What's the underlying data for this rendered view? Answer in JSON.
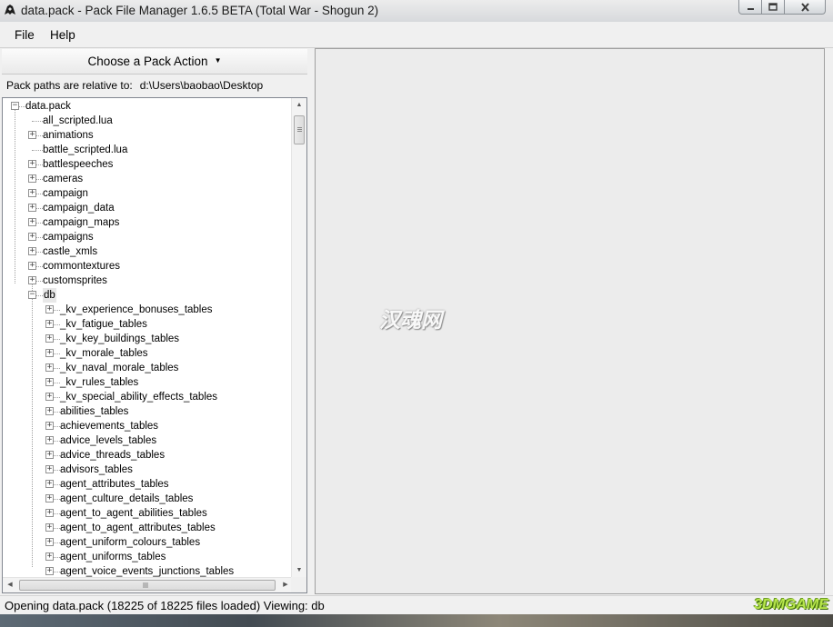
{
  "window": {
    "title": "data.pack - Pack File Manager 1.6.5 BETA (Total War - Shogun 2)"
  },
  "menu": [
    "File",
    "Help"
  ],
  "left_panel": {
    "action_button": "Choose a Pack Action",
    "paths_label": "Pack paths are relative to:",
    "paths_value": "d:\\Users\\baobao\\Desktop"
  },
  "tree": {
    "root": "data.pack",
    "items": [
      {
        "label": "all_scripted.lua",
        "level": 1,
        "expandable": false
      },
      {
        "label": "animations",
        "level": 1,
        "expandable": true
      },
      {
        "label": "battle_scripted.lua",
        "level": 1,
        "expandable": false
      },
      {
        "label": "battlespeeches",
        "level": 1,
        "expandable": true
      },
      {
        "label": "cameras",
        "level": 1,
        "expandable": true
      },
      {
        "label": "campaign",
        "level": 1,
        "expandable": true
      },
      {
        "label": "campaign_data",
        "level": 1,
        "expandable": true
      },
      {
        "label": "campaign_maps",
        "level": 1,
        "expandable": true
      },
      {
        "label": "campaigns",
        "level": 1,
        "expandable": true
      },
      {
        "label": "castle_xmls",
        "level": 1,
        "expandable": true
      },
      {
        "label": "commontextures",
        "level": 1,
        "expandable": true
      },
      {
        "label": "customsprites",
        "level": 1,
        "expandable": true
      },
      {
        "label": "db",
        "level": 1,
        "expandable": true,
        "expanded": true
      },
      {
        "label": "_kv_experience_bonuses_tables",
        "level": 2,
        "expandable": true
      },
      {
        "label": "_kv_fatigue_tables",
        "level": 2,
        "expandable": true
      },
      {
        "label": "_kv_key_buildings_tables",
        "level": 2,
        "expandable": true
      },
      {
        "label": "_kv_morale_tables",
        "level": 2,
        "expandable": true
      },
      {
        "label": "_kv_naval_morale_tables",
        "level": 2,
        "expandable": true
      },
      {
        "label": "_kv_rules_tables",
        "level": 2,
        "expandable": true
      },
      {
        "label": "_kv_special_ability_effects_tables",
        "level": 2,
        "expandable": true
      },
      {
        "label": "abilities_tables",
        "level": 2,
        "expandable": true
      },
      {
        "label": "achievements_tables",
        "level": 2,
        "expandable": true
      },
      {
        "label": "advice_levels_tables",
        "level": 2,
        "expandable": true
      },
      {
        "label": "advice_threads_tables",
        "level": 2,
        "expandable": true
      },
      {
        "label": "advisors_tables",
        "level": 2,
        "expandable": true
      },
      {
        "label": "agent_attributes_tables",
        "level": 2,
        "expandable": true
      },
      {
        "label": "agent_culture_details_tables",
        "level": 2,
        "expandable": true
      },
      {
        "label": "agent_to_agent_abilities_tables",
        "level": 2,
        "expandable": true
      },
      {
        "label": "agent_to_agent_attributes_tables",
        "level": 2,
        "expandable": true
      },
      {
        "label": "agent_uniform_colours_tables",
        "level": 2,
        "expandable": true
      },
      {
        "label": "agent_uniforms_tables",
        "level": 2,
        "expandable": true
      },
      {
        "label": "agent_voice_events_junctions_tables",
        "level": 2,
        "expandable": true
      }
    ]
  },
  "watermark": "汉魂网",
  "status": {
    "text": "Opening data.pack (18225 of 18225 files loaded) Viewing: db",
    "logo": "3DMGAME"
  },
  "icons": {
    "app": "helmet-icon",
    "minimize": "minimize-icon",
    "maximize": "maximize-icon",
    "close": "close-icon"
  }
}
